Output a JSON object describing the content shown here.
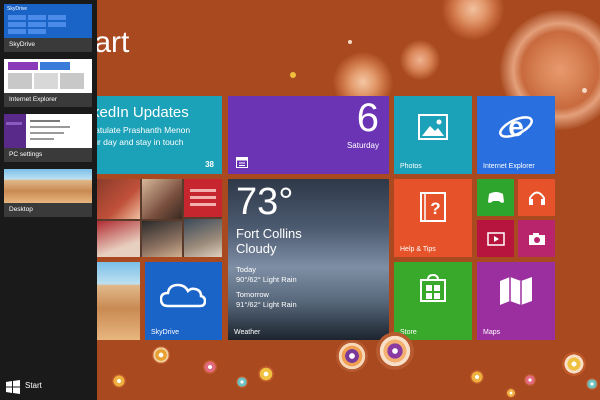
{
  "start_title": "Start",
  "switcher": {
    "apps": [
      {
        "name": "SkyDrive"
      },
      {
        "name": "Internet Explorer"
      },
      {
        "name": "PC settings"
      },
      {
        "name": "Desktop"
      }
    ],
    "start_label": "Start",
    "skydrive_thumb_title": "SkyDrive"
  },
  "tiles": {
    "linkedin": {
      "title": "LinkedIn Updates",
      "line1": "Congratulate Prashanth Menon",
      "line2": "for your day and stay in touch",
      "count": "38"
    },
    "calendar": {
      "day_number": "6",
      "day_name": "Saturday"
    },
    "photos": {
      "label": "Photos"
    },
    "ie": {
      "label": "Internet Explorer"
    },
    "weather": {
      "temp": "73°",
      "city": "Fort Collins",
      "condition": "Cloudy",
      "today_label": "Today",
      "today_forecast": "90°/62° Light Rain",
      "tomorrow_label": "Tomorrow",
      "tomorrow_forecast": "91°/62° Light Rain",
      "label": "Weather"
    },
    "help": {
      "label": "Help & Tips"
    },
    "skydrive": {
      "label": "SkyDrive"
    },
    "store": {
      "label": "Store"
    },
    "maps": {
      "label": "Maps"
    }
  },
  "colors": {
    "background": "#a8491f",
    "linkedin": "#1ba1b8",
    "calendar": "#6b34b5",
    "photos": "#1ba1b8",
    "ie": "#2a6fe0",
    "skydrive": "#1a64c8",
    "help": "#e6532a",
    "store": "#38a92a",
    "maps": "#9c2fa0",
    "small_green": "#2ea62e",
    "small_orange": "#e6532a",
    "small_crimson": "#b8153e",
    "small_magenta": "#b8256c"
  },
  "icons": [
    "windows-logo-icon",
    "photos-icon",
    "internet-explorer-icon",
    "calendar-icon",
    "help-tips-icon",
    "skydrive-cloud-icon",
    "store-icon",
    "maps-icon",
    "xbox-games-icon",
    "headphones-music-icon",
    "video-icon",
    "camera-icon"
  ]
}
